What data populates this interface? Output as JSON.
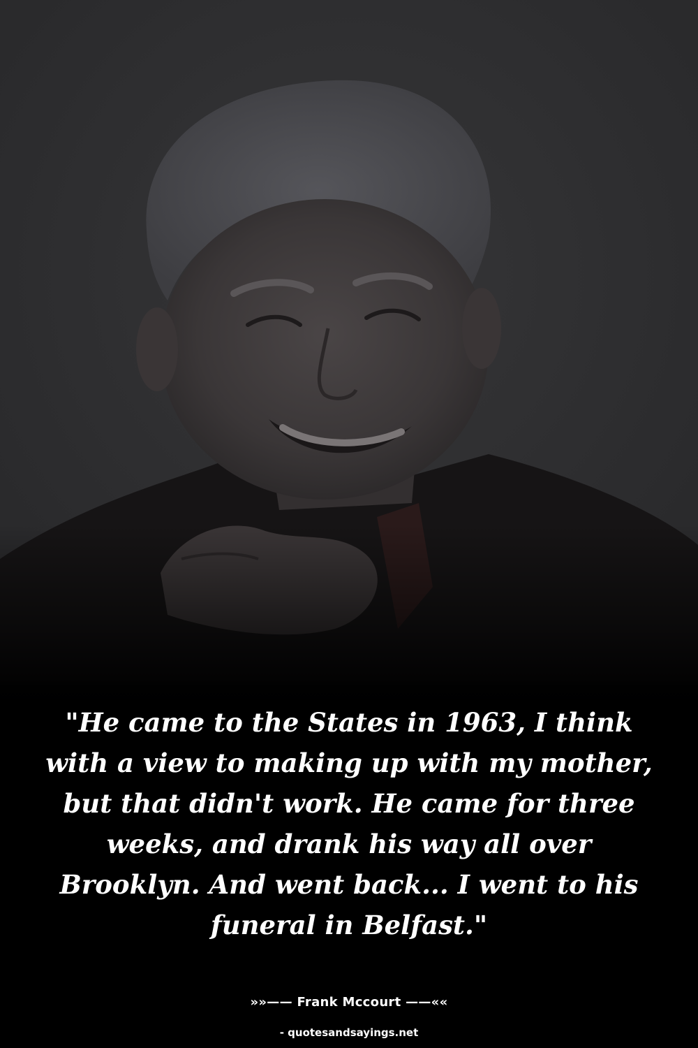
{
  "quote": {
    "text": "\"He came to the States in 1963, I think with a view to making up with my mother, but that didn't work. He came for three weeks, and drank his way all over Brooklyn. And went back... I went to his funeral in Belfast.\""
  },
  "attribution": {
    "text": "»»—— Frank Mccourt ——««"
  },
  "source": {
    "text": "- quotesandsayings.net"
  }
}
